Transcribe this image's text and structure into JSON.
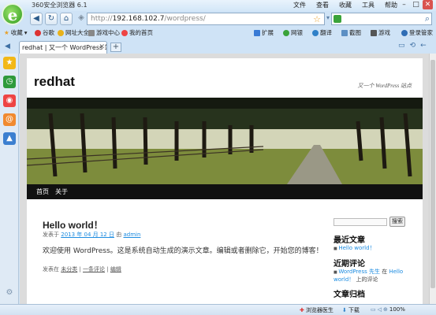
{
  "app": {
    "title": "360安全浏览器 6.1",
    "menus": [
      "文件",
      "查看",
      "收藏",
      "工具",
      "帮助"
    ]
  },
  "nav": {
    "url_prefix": "http://",
    "url_host": "192.168.102.7",
    "url_path": "/wordpress/"
  },
  "bookmarks": {
    "favorites": "收藏",
    "items": [
      "谷歌",
      "网址大全",
      "游戏中心",
      "我的首页"
    ],
    "right": [
      "扩展",
      "网银",
      "翻译",
      "截图",
      "游戏",
      "登录管家"
    ]
  },
  "tab": {
    "title": "redhat | 又一个 WordPress 站点"
  },
  "site": {
    "title": "redhat",
    "tagline": "又一个 WordPress 站点",
    "menu": [
      "首页",
      "关于"
    ]
  },
  "post": {
    "title": "Hello world！",
    "meta_prefix": "发表于",
    "date": "2013 年 04 月 12 日",
    "by": "由",
    "author": "admin",
    "body": "欢迎使用 WordPress。这是系统自动生成的演示文章。编辑或者删除它，开始您的博客！",
    "posted_in": "发表在",
    "category": "未分类",
    "comment": "一条评论",
    "edit": "编辑"
  },
  "widgets": {
    "search_button": "搜索",
    "recent_posts_title": "最近文章",
    "recent_posts": [
      "Hello world！"
    ],
    "recent_comments_title": "近期评论",
    "comment_author": "WordPress 先生",
    "comment_on": "在",
    "comment_post": "Hello world！",
    "comment_suffix": "上的评论",
    "archives_title": "文章归档"
  },
  "status": {
    "doctor": "浏览器医生",
    "download": "下载",
    "zoom": "100%"
  }
}
